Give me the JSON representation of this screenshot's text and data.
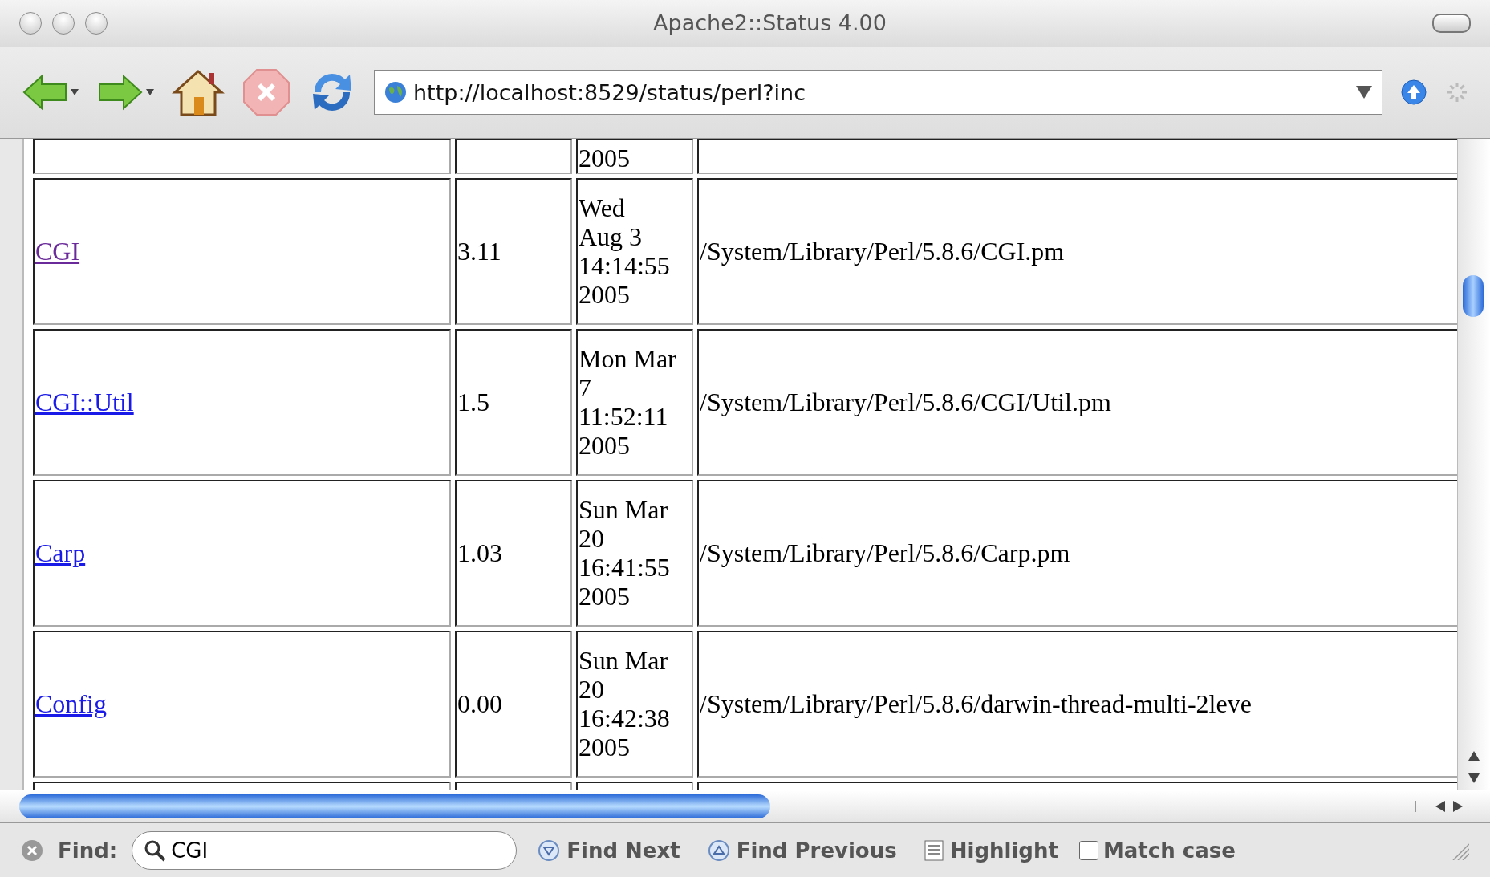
{
  "window": {
    "title": "Apache2::Status 4.00"
  },
  "toolbar": {
    "url": "http://localhost:8529/status/perl?inc"
  },
  "table": {
    "rows": [
      {
        "kind": "partial-top",
        "date_lines": [
          "2005"
        ]
      },
      {
        "kind": "full",
        "module": "CGI",
        "visited": true,
        "version": "3.11",
        "date_lines": [
          "Wed",
          "Aug 3",
          "14:14:55",
          "2005"
        ],
        "path": "/System/Library/Perl/5.8.6/CGI.pm"
      },
      {
        "kind": "full",
        "module": "CGI::Util",
        "visited": false,
        "version": "1.5",
        "date_lines": [
          "Mon Mar",
          "7",
          "11:52:11",
          "2005"
        ],
        "path": "/System/Library/Perl/5.8.6/CGI/Util.pm"
      },
      {
        "kind": "full",
        "module": "Carp",
        "visited": false,
        "version": "1.03",
        "date_lines": [
          "Sun Mar",
          "20",
          "16:41:55",
          "2005"
        ],
        "path": "/System/Library/Perl/5.8.6/Carp.pm"
      },
      {
        "kind": "full",
        "module": "Config",
        "visited": false,
        "version": "0.00",
        "date_lines": [
          "Sun Mar",
          "20",
          "16:42:38",
          "2005"
        ],
        "path": "/System/Library/Perl/5.8.6/darwin-thread-multi-2leve"
      },
      {
        "kind": "partial-bottom",
        "date_lines": []
      }
    ]
  },
  "find_bar": {
    "label": "Find:",
    "value": "CGI",
    "buttons": [
      {
        "kind": "down",
        "label": "Find Next"
      },
      {
        "kind": "up",
        "label": "Find Previous"
      },
      {
        "kind": "list",
        "label": "Highlight"
      }
    ],
    "match_case": {
      "label": "Match case",
      "checked": false
    }
  }
}
